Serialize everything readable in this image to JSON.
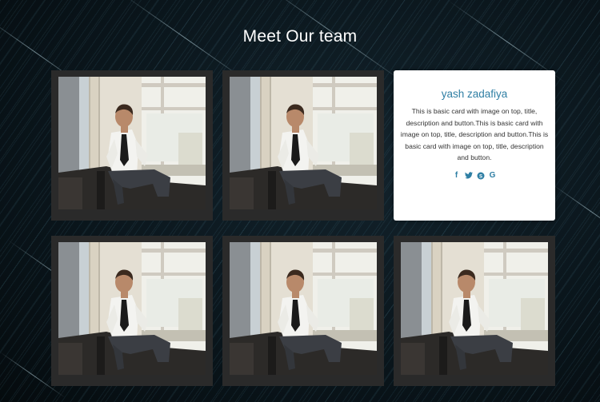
{
  "page": {
    "title": "Meet Our team"
  },
  "team_cards": [
    {
      "type": "photo",
      "image": "man-in-suit-photo"
    },
    {
      "type": "photo",
      "image": "man-in-suit-photo"
    },
    {
      "type": "info",
      "name": "yash zadafiya",
      "description": "This is basic card with image on top, title, description and button.This is basic card with image on top, title, description and button.This is basic card with image on top, title, description and button.",
      "socials": [
        {
          "icon": "facebook-icon",
          "glyph": "f"
        },
        {
          "icon": "twitter-icon",
          "glyph": "🐦"
        },
        {
          "icon": "skype-icon",
          "glyph": "S"
        },
        {
          "icon": "google-icon",
          "glyph": "G"
        }
      ]
    },
    {
      "type": "photo",
      "image": "man-in-suit-photo"
    },
    {
      "type": "photo",
      "image": "man-in-suit-photo"
    },
    {
      "type": "photo",
      "image": "man-in-suit-photo"
    }
  ],
  "colors": {
    "accent": "#2f7fa4",
    "card_frame": "#2a2a2a",
    "background": "#0a151b"
  }
}
